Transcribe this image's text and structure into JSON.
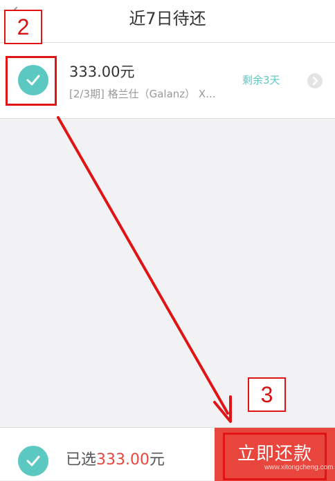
{
  "header": {
    "title": "近7日待还",
    "back_icon": "chevron-left-icon"
  },
  "bill": {
    "amount": "333.00元",
    "description": "[2/3期] 格兰仕（Galanz） X...",
    "remaining": "剩余3天",
    "check_icon": "check-icon",
    "detail_icon": "chevron-right-icon"
  },
  "footer": {
    "selected_prefix": "已选",
    "selected_amount": "333.00",
    "selected_unit": "元",
    "pay_label": "立即还款"
  },
  "annotations": {
    "step_2": "2",
    "step_3": "3"
  },
  "watermark": "www.xitongcheng.com",
  "colors": {
    "accent_teal": "#5cc8c2",
    "pay_red": "#e8453c",
    "annotation_red": "#e01414"
  }
}
